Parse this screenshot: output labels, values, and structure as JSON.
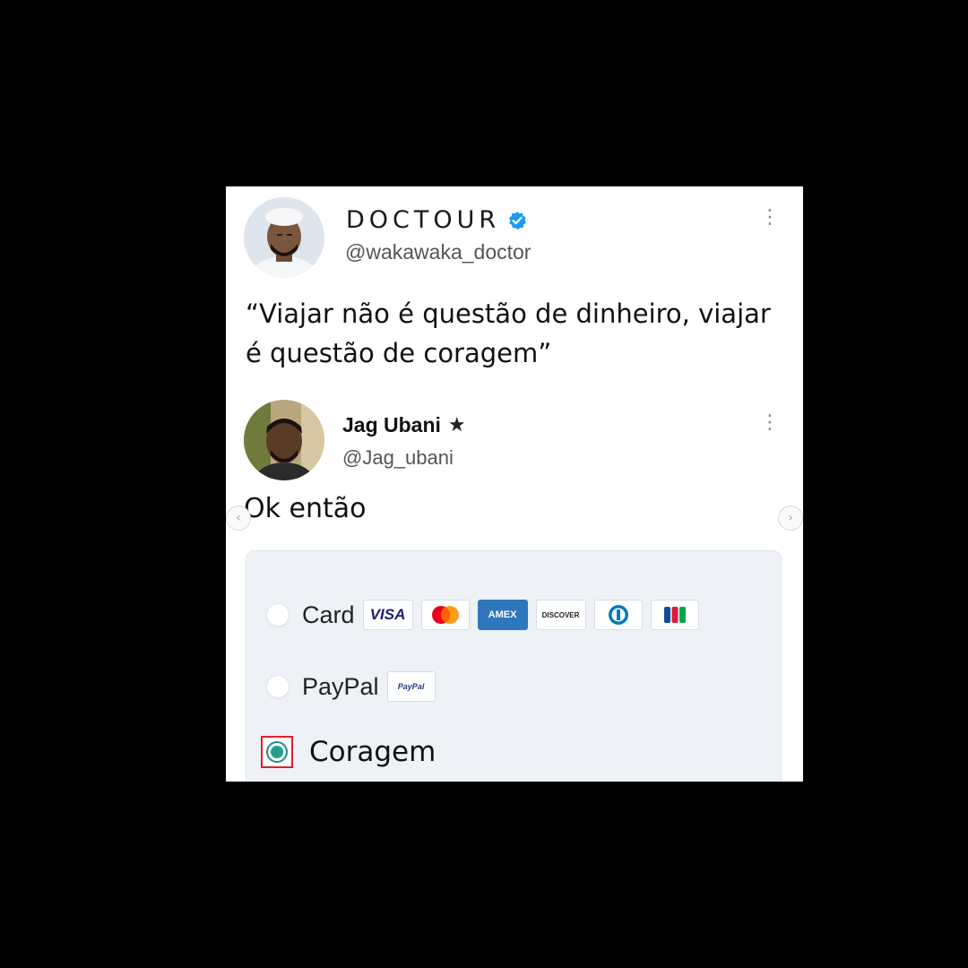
{
  "tweet": {
    "author_name": "DOCTOUR",
    "author_handle": "@wakawaka_doctor",
    "verified_icon": "verified-badge-icon",
    "more_icon": "more-options-icon",
    "text": "“Viajar não é questão de dinheiro, viajar\né questão de coragem”"
  },
  "reply": {
    "author_name": "Jag Ubani",
    "author_star": "★",
    "author_handle": "@Jag_ubani",
    "more_icon": "more-options-icon",
    "text": "Ok então"
  },
  "carousel": {
    "prev_icon": "‹",
    "next_icon": "›"
  },
  "payment": {
    "options": [
      {
        "label": "Card",
        "selected": false
      },
      {
        "label": "PayPal",
        "selected": false
      },
      {
        "label": "Coragem",
        "selected": true
      }
    ],
    "card_brands": {
      "visa": "VISA",
      "amex": "AMEX",
      "discover": "DISCOVER"
    },
    "paypal_badge": "PayPal"
  },
  "colors": {
    "verified": "#1d9bf0",
    "selected_border": "#e0202a",
    "selected_radio": "#22a08f",
    "amex": "#2e77bc"
  }
}
